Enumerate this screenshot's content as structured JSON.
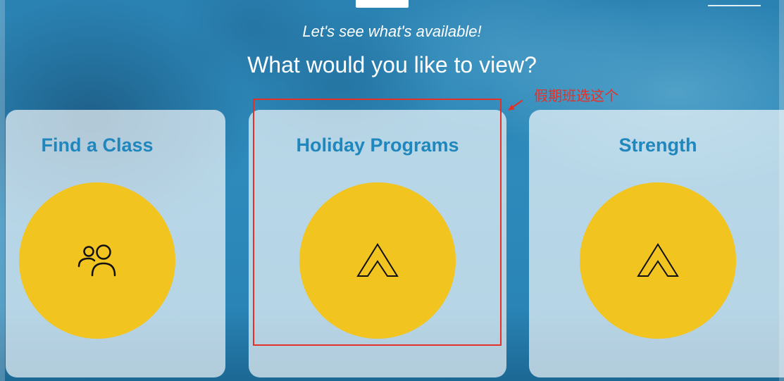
{
  "header": {
    "subtitle": "Let's see what's available!",
    "title": "What would you like to view?"
  },
  "cards": [
    {
      "title": "Find a Class",
      "icon": "people-icon"
    },
    {
      "title": "Holiday Programs",
      "icon": "tent-icon"
    },
    {
      "title": "Strength",
      "icon": "tent-icon"
    }
  ],
  "annotation": {
    "text": "假期班选这个"
  },
  "colors": {
    "accent": "#f2c420",
    "card_title": "#1f87bd",
    "annotation": "#e53027",
    "background": "#2a85b6"
  }
}
